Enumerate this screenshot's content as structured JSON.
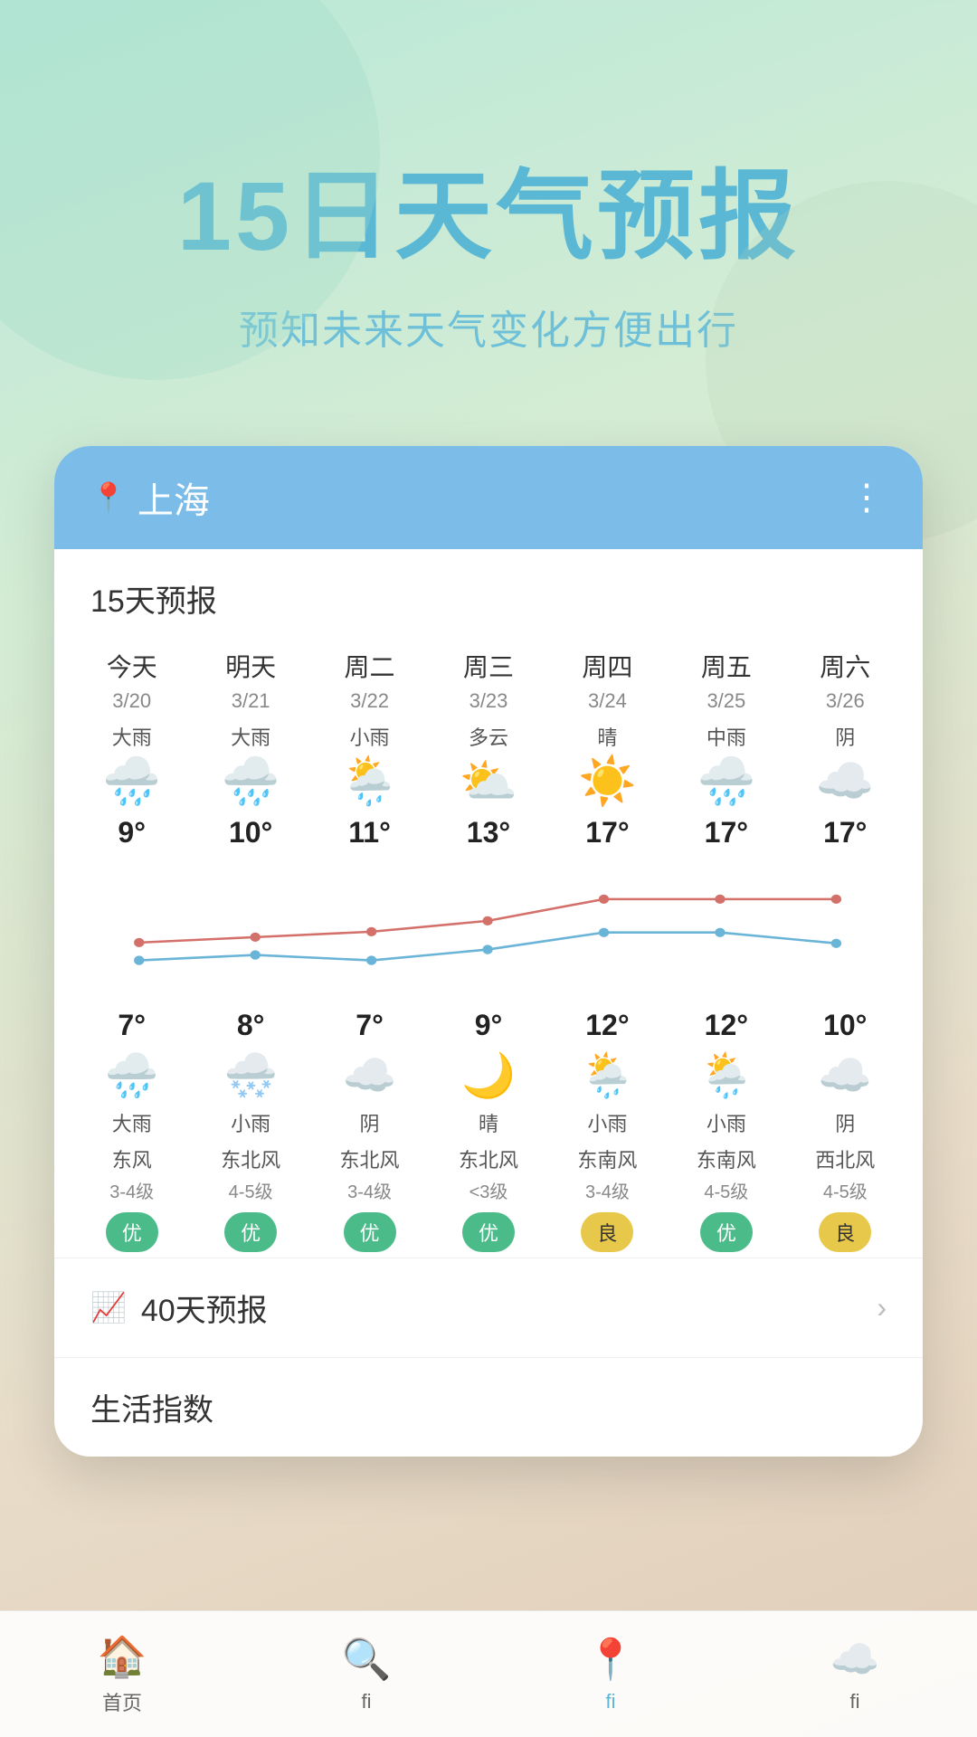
{
  "header": {
    "main_title": "15日天气预报",
    "sub_title": "预知未来天气变化方便出行"
  },
  "app": {
    "city": "上海",
    "forecast_label": "15天预报",
    "days": [
      {
        "name": "今天",
        "date": "3/20",
        "condition": "大雨",
        "icon": "🌧️",
        "high": "9°",
        "low": "7°",
        "night_icon": "🌧️",
        "night_condition": "大雨",
        "wind_dir": "东风",
        "wind_level": "3-4级",
        "air": "优",
        "air_class": "air-good"
      },
      {
        "name": "明天",
        "date": "3/21",
        "condition": "大雨",
        "icon": "🌧️",
        "high": "10°",
        "low": "8°",
        "night_icon": "🌨️",
        "night_condition": "小雨",
        "wind_dir": "东北风",
        "wind_level": "4-5级",
        "air": "优",
        "air_class": "air-good"
      },
      {
        "name": "周二",
        "date": "3/22",
        "condition": "小雨",
        "icon": "🌦️",
        "high": "11°",
        "low": "7°",
        "night_icon": "☁️",
        "night_condition": "阴",
        "wind_dir": "东北风",
        "wind_level": "3-4级",
        "air": "优",
        "air_class": "air-good"
      },
      {
        "name": "周三",
        "date": "3/23",
        "condition": "多云",
        "icon": "⛅",
        "high": "13°",
        "low": "9°",
        "night_icon": "🌙",
        "night_condition": "晴",
        "wind_dir": "东北风",
        "wind_level": "<3级",
        "air": "优",
        "air_class": "air-good"
      },
      {
        "name": "周四",
        "date": "3/24",
        "condition": "晴",
        "icon": "☀️",
        "high": "17°",
        "low": "12°",
        "night_icon": "🌦️",
        "night_condition": "小雨",
        "wind_dir": "东南风",
        "wind_level": "3-4级",
        "air": "良",
        "air_class": "air-ok"
      },
      {
        "name": "周五",
        "date": "3/25",
        "condition": "中雨",
        "icon": "🌧️",
        "high": "17°",
        "low": "12°",
        "night_icon": "🌦️",
        "night_condition": "小雨",
        "wind_dir": "东南风",
        "wind_level": "4-5级",
        "air": "优",
        "air_class": "air-good"
      },
      {
        "name": "周六",
        "date": "3/26",
        "condition": "阴",
        "icon": "☁️",
        "high": "17°",
        "low": "10°",
        "night_icon": "☁️",
        "night_condition": "阴",
        "wind_dir": "西北风",
        "wind_level": "4-5级",
        "air": "良",
        "air_class": "air-ok"
      }
    ],
    "forty_day": "40天预报",
    "life_index": "生活指数"
  },
  "nav": {
    "items": [
      {
        "label": "首页",
        "icon": "🏠",
        "active": false
      },
      {
        "label": "fi",
        "icon": "🔍",
        "active": false
      },
      {
        "label": "fi",
        "icon": "📍",
        "active": true
      },
      {
        "label": "fi",
        "icon": "☁️",
        "active": false
      }
    ]
  }
}
